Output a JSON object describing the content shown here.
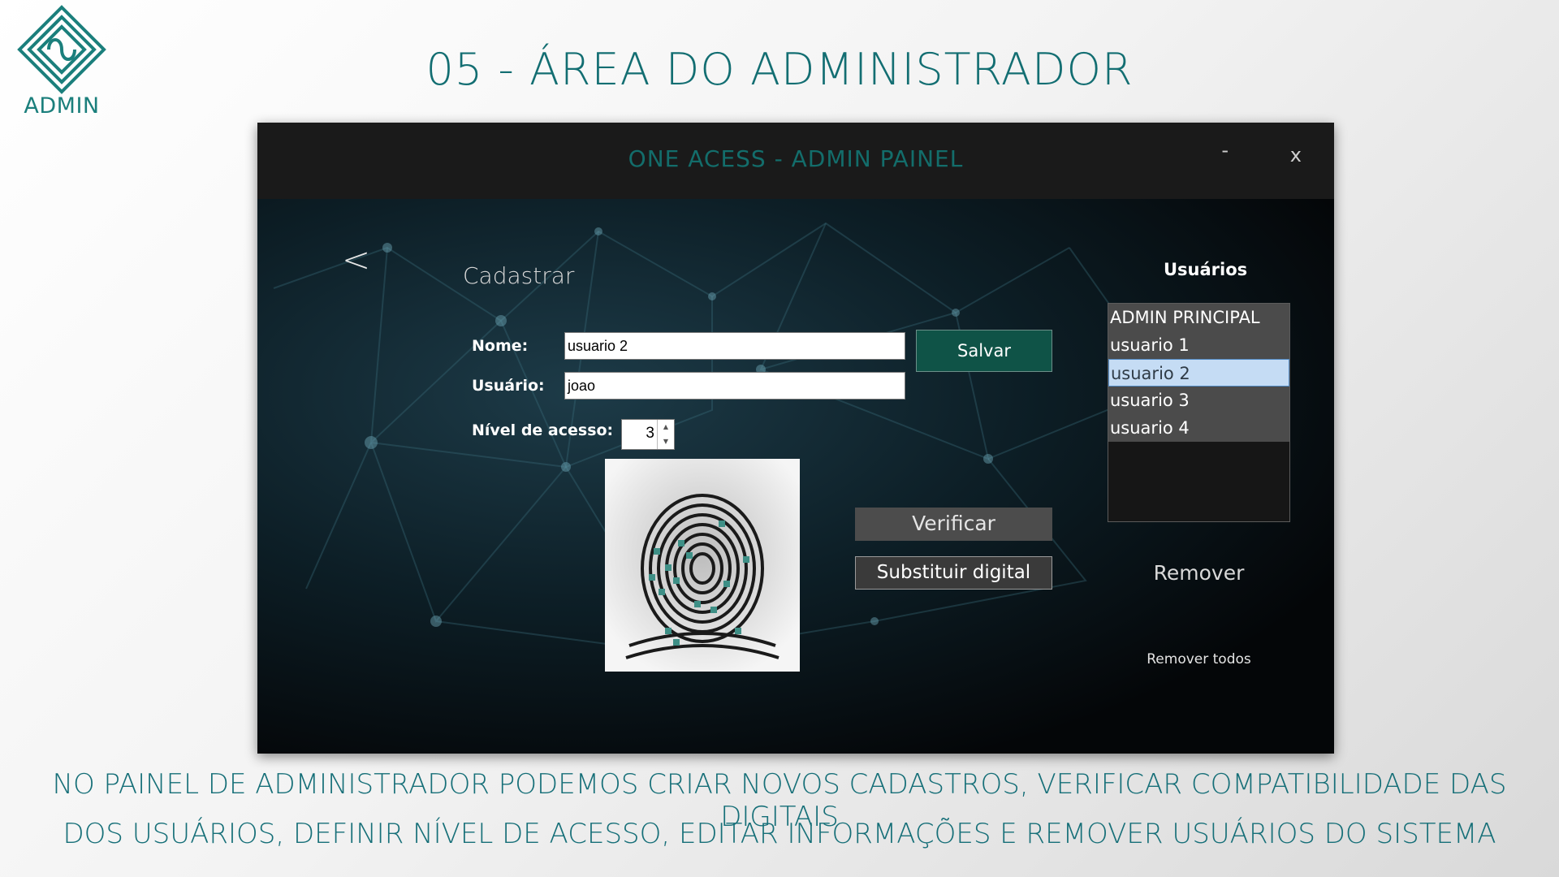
{
  "logo": {
    "text": "ADMIN"
  },
  "slide": {
    "title": "05 - ÁREA DO ADMINISTRADOR",
    "caption_line1": "NO PAINEL DE ADMINISTRADOR PODEMOS CRIAR NOVOS CADASTROS, VERIFICAR COMPATIBILIDADE DAS DIGITAIS",
    "caption_line2": "DOS USUÁRIOS, DEFINIR NÍVEL DE ACESSO, EDITAR INFORMAÇÕES E REMOVER USUÁRIOS DO SISTEMA"
  },
  "window": {
    "title": "ONE ACESS - ADMIN PAINEL",
    "minimize": "-",
    "close": "x"
  },
  "form": {
    "back": "<",
    "section_title": "Cadastrar",
    "name_label": "Nome:",
    "name_value": "usuario 2",
    "user_label": "Usuário:",
    "user_value": "joao",
    "level_label": "Nível de acesso:",
    "level_value": "3",
    "save_label": "Salvar",
    "verify_label": "Verificar",
    "replace_label": "Substituir digital"
  },
  "users": {
    "title": "Usuários",
    "items": [
      "ADMIN PRINCIPAL",
      "usuario 1",
      "usuario 2",
      "usuario 3",
      "usuario 4"
    ],
    "selected": "usuario 2",
    "remove_label": "Remover",
    "remove_all_label": "Remover todos"
  },
  "colors": {
    "accent": "#136e72",
    "save_button": "#0f5347",
    "selection": "#c5dcf4",
    "minutiae": "#3e8f86"
  },
  "icons": {
    "logo": "interlocking-knot-icon",
    "fingerprint": "fingerprint-icon"
  }
}
